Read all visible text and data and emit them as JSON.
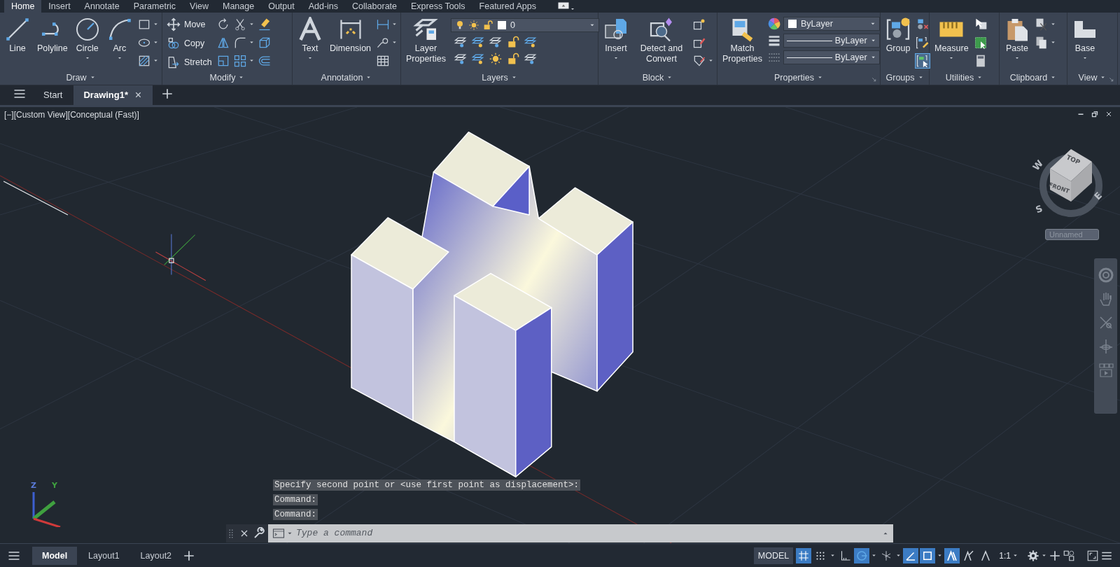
{
  "ribbon_tabs": [
    {
      "label": "Home",
      "selected": true
    },
    {
      "label": "Insert",
      "selected": false
    },
    {
      "label": "Annotate",
      "selected": false
    },
    {
      "label": "Parametric",
      "selected": false
    },
    {
      "label": "View",
      "selected": false
    },
    {
      "label": "Manage",
      "selected": false
    },
    {
      "label": "Output",
      "selected": false
    },
    {
      "label": "Add-ins",
      "selected": false
    },
    {
      "label": "Collaborate",
      "selected": false
    },
    {
      "label": "Express Tools",
      "selected": false
    },
    {
      "label": "Featured Apps",
      "selected": false
    }
  ],
  "ribbon_panels": [
    {
      "title": "Draw",
      "tools": [
        {
          "label": "Line",
          "kind": "large"
        },
        {
          "label": "Polyline",
          "kind": "large"
        },
        {
          "label": "Circle",
          "kind": "large-menu"
        },
        {
          "label": "Arc",
          "kind": "large-menu"
        }
      ]
    },
    {
      "title": "Modify",
      "tools": [
        {
          "label": "Move",
          "kind": "small"
        },
        {
          "label": "Copy",
          "kind": "small"
        },
        {
          "label": "Stretch",
          "kind": "small"
        }
      ]
    },
    {
      "title": "Annotation",
      "tools": [
        {
          "label": "Text",
          "kind": "large-menu"
        },
        {
          "label": "Dimension",
          "kind": "large"
        }
      ]
    },
    {
      "title": "Layers",
      "tools": [
        {
          "label": "Layer Properties",
          "kind": "large"
        },
        {
          "label": "0",
          "kind": "layer-combo"
        }
      ]
    },
    {
      "title": "Block",
      "tools": [
        {
          "label": "Insert",
          "kind": "large-menu"
        },
        {
          "label": "Detect and Convert",
          "kind": "large"
        }
      ]
    },
    {
      "title": "Properties",
      "tools": [
        {
          "label": "Match Properties",
          "kind": "large"
        },
        {
          "label": "ByLayer",
          "kind": "color-combo"
        },
        {
          "label": "ByLayer",
          "kind": "line-combo"
        },
        {
          "label": "ByLayer",
          "kind": "line-combo"
        }
      ]
    },
    {
      "title": "Groups",
      "tools": [
        {
          "label": "Group",
          "kind": "large"
        }
      ],
      "toggle_on": true
    },
    {
      "title": "Utilities",
      "tools": [
        {
          "label": "Measure",
          "kind": "large-menu"
        }
      ]
    },
    {
      "title": "Clipboard",
      "tools": [
        {
          "label": "Paste",
          "kind": "large-menu"
        }
      ]
    },
    {
      "title": "View",
      "tools": [
        {
          "label": "Base",
          "kind": "large-menu"
        }
      ]
    }
  ],
  "file_tabs": [
    {
      "label": "Start",
      "selected": false
    },
    {
      "label": "Drawing1*",
      "selected": true
    }
  ],
  "viewport": {
    "label": "[−][Custom View][Conceptual (Fast)]",
    "viewcube": {
      "faces": [
        "TOP",
        "FRONT"
      ],
      "compass": [
        "W",
        "S",
        "E"
      ],
      "view_name": "Unnamed"
    },
    "ucs_labels": [
      "Z",
      "Y"
    ]
  },
  "command_history": [
    "Specify second point or <use first point as displacement>:",
    "Command:",
    "Command:"
  ],
  "command_line": {
    "placeholder": "Type a command"
  },
  "layout_tabs": [
    {
      "label": "Model",
      "selected": true
    },
    {
      "label": "Layout1",
      "selected": false
    },
    {
      "label": "Layout2",
      "selected": false
    }
  ],
  "status_bar": {
    "space": "MODEL",
    "scale": "1:1",
    "toggles": [
      {
        "on": true
      },
      {
        "on": false
      },
      {
        "on": false
      },
      {
        "on": true
      },
      {
        "on": false
      },
      {
        "on": true
      },
      {
        "on": true
      },
      {
        "on": true
      },
      {
        "on": false
      },
      {
        "on": false
      }
    ]
  }
}
